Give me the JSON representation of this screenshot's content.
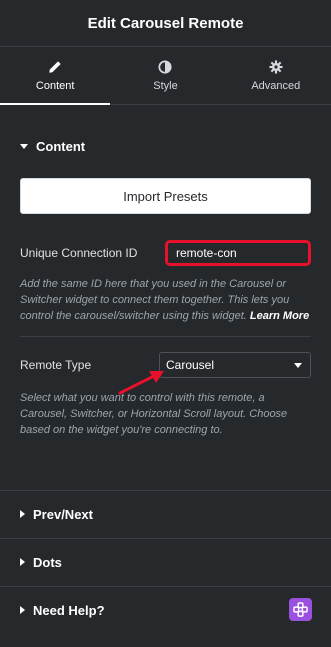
{
  "header": {
    "title": "Edit Carousel Remote"
  },
  "tabs": [
    {
      "label": "Content",
      "icon": "pencil-icon",
      "active": true
    },
    {
      "label": "Style",
      "icon": "half-circle-icon",
      "active": false
    },
    {
      "label": "Advanced",
      "icon": "gear-icon",
      "active": false
    }
  ],
  "content_section": {
    "title": "Content",
    "import_button": "Import Presets",
    "connection_id": {
      "label": "Unique Connection ID",
      "value": "remote-con",
      "highlight_color": "#e8102b"
    },
    "connection_desc": "Add the same ID here that you used in the Carousel or Switcher widget to connect them together. This lets you control the carousel/switcher using this widget.",
    "learn_more": "Learn More",
    "remote_type": {
      "label": "Remote Type",
      "selected": "Carousel"
    },
    "remote_type_desc": "Select what you want to control with this remote, a Carousel, Switcher, or Horizontal Scroll layout. Choose based on the widget you're connecting to."
  },
  "collapsed_sections": [
    {
      "title": "Prev/Next"
    },
    {
      "title": "Dots"
    },
    {
      "title": "Need Help?",
      "icon": "help-badge-icon"
    }
  ],
  "colors": {
    "background": "#26292c",
    "annotation_red": "#e8102b",
    "help_badge": "#9b51e0"
  }
}
